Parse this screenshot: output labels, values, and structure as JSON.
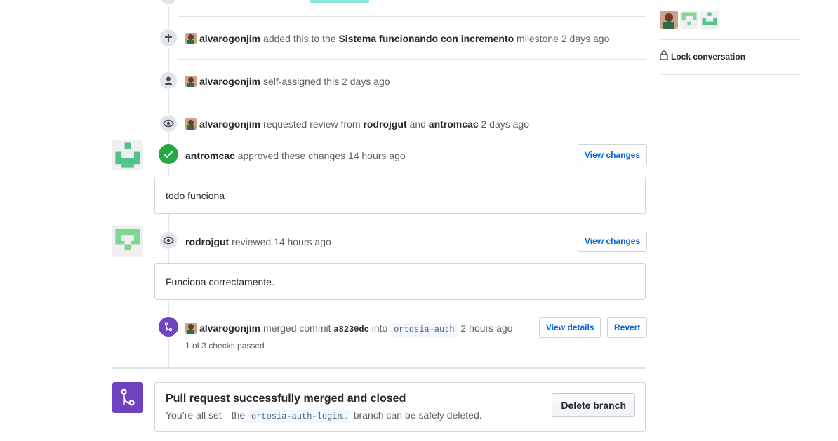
{
  "events": {
    "milestone": {
      "author": "alvarogonjim",
      "text_a": "added this to the",
      "milestone": "Sistema funcionando con incremento",
      "text_b": "milestone",
      "time": "2 days ago"
    },
    "assign": {
      "author": "alvarogonjim",
      "text": "self-assigned this",
      "time": "2 days ago"
    },
    "review_request": {
      "author": "alvarogonjim",
      "text_a": "requested review from",
      "reviewer1": "rodrojgut",
      "text_and": "and",
      "reviewer2": "antromcac",
      "time": "2 days ago"
    },
    "approved": {
      "author": "antromcac",
      "text": "approved these changes",
      "time": "14 hours ago",
      "button": "View changes",
      "comment": "todo funciona"
    },
    "reviewed": {
      "author": "rodrojgut",
      "text": "reviewed",
      "time": "14 hours ago",
      "button": "View changes",
      "comment": "Funciona correctamente."
    },
    "merged": {
      "author": "alvarogonjim",
      "text_a": "merged commit",
      "sha": "a8230dc",
      "text_b": "into",
      "branch": "ortosia-auth",
      "time": "2 hours ago",
      "checks": "1 of 3 checks passed",
      "details_button": "View details",
      "revert_button": "Revert"
    }
  },
  "merge_panel": {
    "title": "Pull request successfully merged and closed",
    "sub_a": "You’re all set—the",
    "branch": "ortosia-auth-login…",
    "sub_b": "branch can be safely deleted.",
    "delete_button": "Delete branch"
  },
  "sidebar": {
    "lock": "Lock conversation"
  },
  "colors": {
    "green": "#28a745",
    "purple": "#6f42c1",
    "link": "#0366d6",
    "identicon_green": "#4fc38a"
  }
}
